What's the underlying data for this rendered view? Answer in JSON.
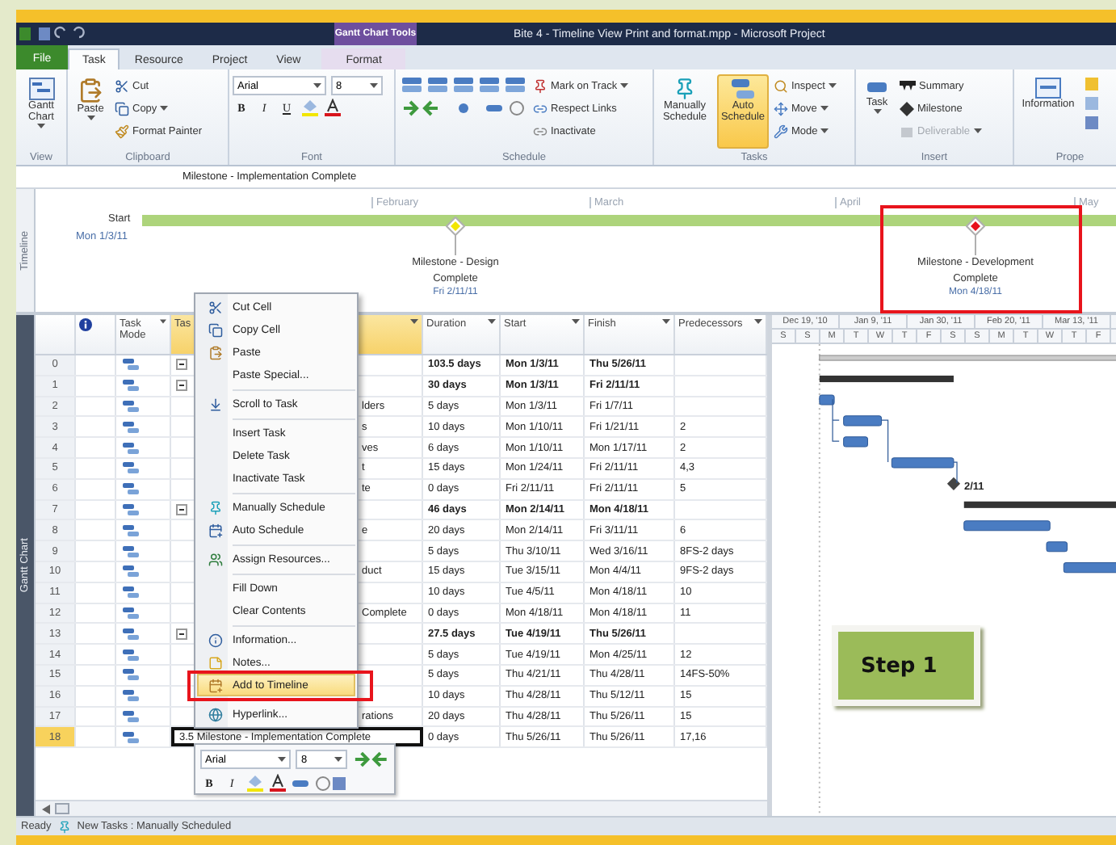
{
  "title_bar": {
    "contextual_tab": "Gantt Chart Tools",
    "title": "Bite 4 - Timeline View Print and format.mpp  -  Microsoft Project"
  },
  "ribbon_tabs": [
    {
      "label": "File",
      "kind": "file",
      "selected": false
    },
    {
      "label": "Task",
      "kind": "normal",
      "selected": true
    },
    {
      "label": "Resource",
      "kind": "normal",
      "selected": false
    },
    {
      "label": "Project",
      "kind": "normal",
      "selected": false
    },
    {
      "label": "View",
      "kind": "normal",
      "selected": false
    },
    {
      "label": "Format",
      "kind": "contextual",
      "selected": false
    }
  ],
  "ribbon": {
    "view": {
      "button": "Gantt Chart",
      "label": "View"
    },
    "clipboard": {
      "paste": "Paste",
      "cut": "Cut",
      "copy": "Copy",
      "format_painter": "Format Painter",
      "label": "Clipboard"
    },
    "font": {
      "family": "Arial",
      "size": "8",
      "bold": "B",
      "italic": "I",
      "underline": "U",
      "label": "Font"
    },
    "schedule": {
      "mark_on_track": "Mark on Track",
      "respect_links": "Respect Links",
      "inactivate": "Inactivate",
      "label": "Schedule"
    },
    "tasks": {
      "manually": "Manually Schedule",
      "auto": "Auto Schedule",
      "auto_selected": true,
      "inspect": "Inspect",
      "move": "Move",
      "mode": "Mode",
      "label": "Tasks"
    },
    "insert": {
      "task": "Task",
      "summary": "Summary",
      "milestone": "Milestone",
      "deliverable": "Deliverable",
      "deliverable_disabled": true,
      "label": "Insert"
    },
    "properties": {
      "information": "Information",
      "label": "Prope"
    }
  },
  "entry_bar": {
    "value": "Milestone - Implementation Complete"
  },
  "timeline": {
    "label": "Timeline",
    "start": "Start",
    "start_date": "Mon 1/3/11",
    "months": [
      "February",
      "March",
      "April",
      "May"
    ],
    "milestones": [
      {
        "title": "Milestone - Design Complete",
        "date": "Fri 2/11/11",
        "color": "#f2e600"
      },
      {
        "title": "Milestone - Development Complete",
        "date": "Mon 4/18/11",
        "color": "#e8101c"
      }
    ]
  },
  "gantt": {
    "label": "Gantt Chart",
    "columns": [
      {
        "kind": "number",
        "selected": false
      },
      {
        "kind": "indicator",
        "selected": false
      },
      {
        "label": "Task Mode",
        "kind": "mode",
        "selected": false
      },
      {
        "label": "Tas",
        "kind": "name",
        "selected": true
      },
      {
        "label": "Duration",
        "kind": "text",
        "selected": false
      },
      {
        "label": "Start",
        "kind": "text",
        "selected": false
      },
      {
        "label": "Finish",
        "kind": "text",
        "selected": false
      },
      {
        "label": "Predecessors",
        "kind": "text",
        "selected": false
      }
    ],
    "rows": [
      {
        "id": "0",
        "name": "",
        "duration": "103.5 days",
        "start": "Mon 1/3/11",
        "finish": "Thu 5/26/11",
        "predecessors": "",
        "summary": true,
        "selected": false
      },
      {
        "id": "1",
        "name": "",
        "duration": "30 days",
        "start": "Mon 1/3/11",
        "finish": "Fri 2/11/11",
        "predecessors": "",
        "summary": true,
        "selected": false
      },
      {
        "id": "2",
        "name": "lders",
        "duration": "5 days",
        "start": "Mon 1/3/11",
        "finish": "Fri 1/7/11",
        "predecessors": "",
        "summary": false,
        "selected": false
      },
      {
        "id": "3",
        "name": "s",
        "duration": "10 days",
        "start": "Mon 1/10/11",
        "finish": "Fri 1/21/11",
        "predecessors": "2",
        "summary": false,
        "selected": false
      },
      {
        "id": "4",
        "name": "ves",
        "duration": "6 days",
        "start": "Mon 1/10/11",
        "finish": "Mon 1/17/11",
        "predecessors": "2",
        "summary": false,
        "selected": false
      },
      {
        "id": "5",
        "name": "t",
        "duration": "15 days",
        "start": "Mon 1/24/11",
        "finish": "Fri 2/11/11",
        "predecessors": "4,3",
        "summary": false,
        "selected": false
      },
      {
        "id": "6",
        "name": "te",
        "duration": "0 days",
        "start": "Fri 2/11/11",
        "finish": "Fri 2/11/11",
        "predecessors": "5",
        "summary": false,
        "selected": false
      },
      {
        "id": "7",
        "name": "",
        "duration": "46 days",
        "start": "Mon 2/14/11",
        "finish": "Mon 4/18/11",
        "predecessors": "",
        "summary": true,
        "selected": false
      },
      {
        "id": "8",
        "name": "e",
        "duration": "20 days",
        "start": "Mon 2/14/11",
        "finish": "Fri 3/11/11",
        "predecessors": "6",
        "summary": false,
        "selected": false
      },
      {
        "id": "9",
        "name": "",
        "duration": "5 days",
        "start": "Thu 3/10/11",
        "finish": "Wed 3/16/11",
        "predecessors": "8FS-2 days",
        "summary": false,
        "selected": false
      },
      {
        "id": "10",
        "name": "duct",
        "duration": "15 days",
        "start": "Tue 3/15/11",
        "finish": "Mon 4/4/11",
        "predecessors": "9FS-2 days",
        "summary": false,
        "selected": false
      },
      {
        "id": "11",
        "name": "",
        "duration": "10 days",
        "start": "Tue 4/5/11",
        "finish": "Mon 4/18/11",
        "predecessors": "10",
        "summary": false,
        "selected": false
      },
      {
        "id": "12",
        "name": "Complete",
        "duration": "0 days",
        "start": "Mon 4/18/11",
        "finish": "Mon 4/18/11",
        "predecessors": "11",
        "summary": false,
        "selected": false
      },
      {
        "id": "13",
        "name": "",
        "duration": "27.5 days",
        "start": "Tue 4/19/11",
        "finish": "Thu 5/26/11",
        "predecessors": "",
        "summary": true,
        "selected": false
      },
      {
        "id": "14",
        "name": "",
        "duration": "5 days",
        "start": "Tue 4/19/11",
        "finish": "Mon 4/25/11",
        "predecessors": "12",
        "summary": false,
        "selected": false
      },
      {
        "id": "15",
        "name": "",
        "duration": "5 days",
        "start": "Thu 4/21/11",
        "finish": "Thu 4/28/11",
        "predecessors": "14FS-50%",
        "summary": false,
        "selected": false
      },
      {
        "id": "16",
        "name": "",
        "duration": "10 days",
        "start": "Thu 4/28/11",
        "finish": "Thu 5/12/11",
        "predecessors": "15",
        "summary": false,
        "selected": false
      },
      {
        "id": "17",
        "name": "rations",
        "duration": "20 days",
        "start": "Thu 4/28/11",
        "finish": "Thu 5/26/11",
        "predecessors": "15",
        "summary": false,
        "selected": false
      },
      {
        "id": "18",
        "name": "3.5 Milestone - Implementation Complete",
        "duration": "0 days",
        "start": "Thu 5/26/11",
        "finish": "Thu 5/26/11",
        "predecessors": "17,16",
        "summary": false,
        "selected": true
      }
    ],
    "timescale_top": [
      "Dec 19, '10",
      "Jan 9, '11",
      "Jan 30, '11",
      "Feb 20, '11",
      "Mar 13, '11"
    ],
    "timescale_days": [
      "S",
      "S",
      "M",
      "T",
      "W",
      "T",
      "F",
      "S",
      "S",
      "M",
      "T",
      "W",
      "T",
      "F"
    ],
    "milestone_label": "2/11"
  },
  "context_menu": [
    [
      {
        "label": "Cut Cell",
        "selected": false
      },
      {
        "label": "Copy Cell",
        "selected": false
      },
      {
        "label": "Paste",
        "selected": false
      },
      {
        "label": "Paste Special...",
        "selected": false
      }
    ],
    [
      {
        "label": "Scroll to Task",
        "selected": false
      }
    ],
    [
      {
        "label": "Insert Task",
        "selected": false
      },
      {
        "label": "Delete Task",
        "selected": false
      },
      {
        "label": "Inactivate Task",
        "selected": false
      }
    ],
    [
      {
        "label": "Manually Schedule",
        "selected": false
      },
      {
        "label": "Auto Schedule",
        "selected": false
      }
    ],
    [
      {
        "label": "Assign Resources...",
        "selected": false
      }
    ],
    [
      {
        "label": "Fill Down",
        "selected": false
      },
      {
        "label": "Clear Contents",
        "selected": false
      }
    ],
    [
      {
        "label": "Information...",
        "selected": false
      },
      {
        "label": "Notes...",
        "selected": false
      },
      {
        "label": "Add to Timeline",
        "selected": true
      }
    ],
    [
      {
        "label": "Hyperlink...",
        "selected": false
      }
    ]
  ],
  "mini_toolbar": {
    "font": "Arial",
    "size": "8",
    "bold": "B",
    "italic": "I"
  },
  "callout": {
    "text": "Step 1"
  },
  "status_bar": {
    "mode": "Ready",
    "new_tasks": "New Tasks : Manually Scheduled"
  }
}
